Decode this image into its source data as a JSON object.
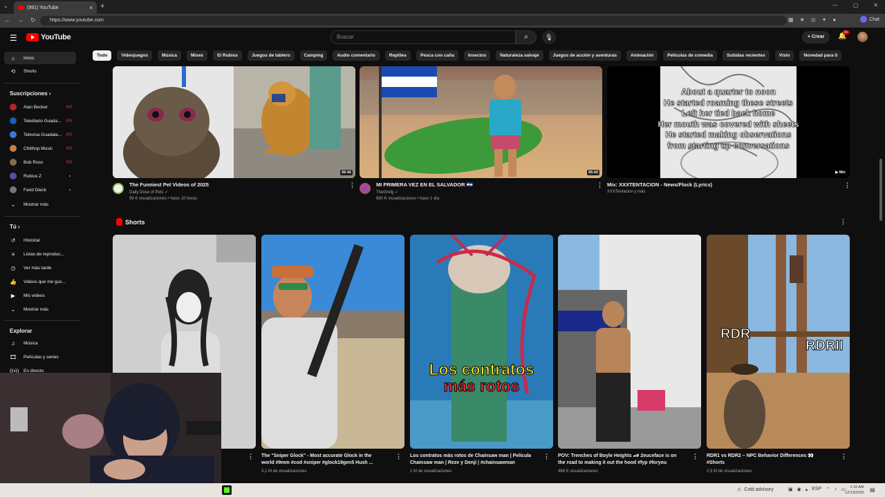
{
  "browser": {
    "tab_title": "(991) YouTube",
    "tab_close": "×",
    "new_tab": "+",
    "url": "https://www.youtube.com",
    "chat_label": "Chat",
    "win_controls": [
      "—",
      "▢",
      "✕"
    ]
  },
  "header": {
    "logo_text": "YouTube",
    "search_placeholder": "Buscar",
    "create_label": "+ Crear",
    "notif_badge": "9+"
  },
  "chips": [
    "Todo",
    "Videojuegos",
    "Música",
    "Mixes",
    "El Rubius",
    "Juegos de tablero",
    "Camping",
    "Audio comentario",
    "Reptiles",
    "Pesca con caña",
    "Insectos",
    "Naturaleza salvaje",
    "Juegos de acción y aventuras",
    "Animación",
    "Películas de comedia",
    "Subidas recientes",
    "Visto",
    "Novedad para ti"
  ],
  "sidebar": {
    "main": [
      {
        "label": "Inicio",
        "icon": "home-icon"
      },
      {
        "label": "Shorts",
        "icon": "shorts-icon"
      }
    ],
    "subs_header": "Suscripciones ›",
    "subs": [
      {
        "label": "Alan Becker",
        "color": "#b22",
        "live": true
      },
      {
        "label": "Telediario Guada...",
        "color": "#1a5fb4",
        "live": true
      },
      {
        "label": "Televisa Guadala...",
        "color": "#3b77d6",
        "live": true
      },
      {
        "label": "Chilihop Music",
        "color": "#c08050",
        "live": true
      },
      {
        "label": "Bob Ross",
        "color": "#8a6a4a",
        "live": true
      },
      {
        "label": "Rubius Z",
        "color": "#5a4aa8",
        "live": false
      },
      {
        "label": "Farid Dieck",
        "color": "#777",
        "live": false
      }
    ],
    "more_label": "Mostrar más",
    "live_mark": "((•))",
    "you_header": "Tú ›",
    "you": [
      {
        "label": "Historial",
        "icon": "history-icon"
      },
      {
        "label": "Listas de reproduc...",
        "icon": "playlist-icon"
      },
      {
        "label": "Ver más tarde",
        "icon": "clock-icon"
      },
      {
        "label": "Videos que me gus...",
        "icon": "like-icon"
      },
      {
        "label": "Mis videos",
        "icon": "my-videos-icon"
      }
    ],
    "more_label2": "Mostrar más",
    "explore_header": "Explorar",
    "explore": [
      {
        "label": "Música",
        "icon": "music-icon"
      },
      {
        "label": "Películas y series",
        "icon": "movies-icon"
      },
      {
        "label": "En directo",
        "icon": "live-icon"
      }
    ]
  },
  "videos": [
    {
      "title": "The Funniest Pet Videos of 2025",
      "channel": "Daily Dose of Pets ✓",
      "meta": "99 K visualizaciones • hace 10 horas",
      "duration": "36:42"
    },
    {
      "title": "MI PRIMERA VEZ EN EL SALVADOR 🇸🇻",
      "channel": "TheGrefg ✓",
      "meta": "680 K visualizaciones • hace 1 día",
      "duration": "35:43"
    },
    {
      "title": "Mix: XXXTENTACION - News/Flock (Lyrics)",
      "channel": "XXXTentacion y más",
      "meta": "",
      "duration": "▶ Mix",
      "lyrics": [
        "About a quarter to noon",
        "He started roaming these streets",
        "Left her tied back home",
        "Her mouth was covered with sheets",
        "He started making observations",
        "from starting up conversations"
      ]
    }
  ],
  "shorts": {
    "header": "Shorts",
    "items": [
      {
        "title": "",
        "views": ""
      },
      {
        "title": "The \"Sniper Glock\" - Most accurate Glock in the world #9mm #cod #sniper #glock19gen5 Hush ...",
        "views": "3,2 M de visualizaciones"
      },
      {
        "title": "Los contratos más rotos de Chainsaw man | Película Chainsaw man | Reze y Denji | #chainsawman",
        "views": "1 M de visualizaciones",
        "overlay1": "Los contratos",
        "overlay2": "más rotos"
      },
      {
        "title": "POV: Trenches of Boyle Heights 🏎 2euceface is on the road to making it out the hood #fyp #foryou",
        "views": "488 K visualizaciones"
      },
      {
        "title": "RDR1 vs RDR2 – NPC Behavior Differences 👀 #Shorts",
        "views": "2,5 M de visualizaciones",
        "overlay1": "RDR",
        "overlay2": "RDRII"
      }
    ]
  },
  "taskbar": {
    "weather": "Cold advisory",
    "lang": "ESP",
    "time": "1:16 AM",
    "date": "12/13/2025"
  }
}
